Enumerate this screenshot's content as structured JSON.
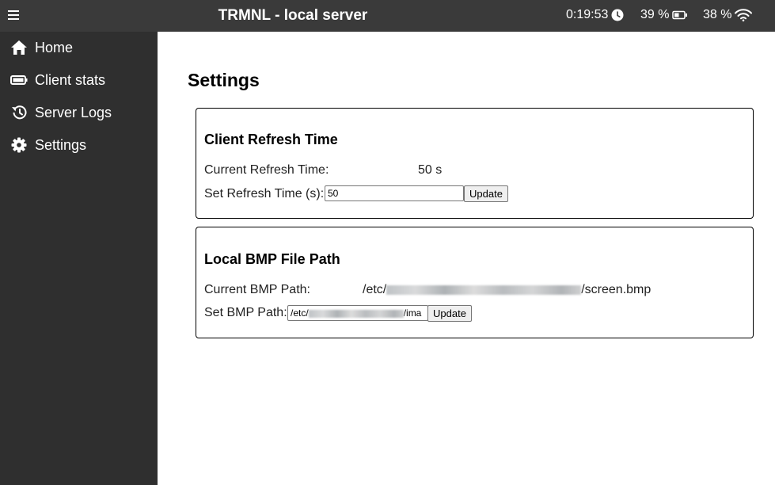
{
  "header": {
    "title": "TRMNL - local server",
    "time": "0:19:53",
    "battery": "39 %",
    "wifi": "38 %"
  },
  "sidebar": {
    "items": [
      {
        "label": "Home",
        "icon": "home-icon"
      },
      {
        "label": "Client stats",
        "icon": "battery-icon"
      },
      {
        "label": "Server Logs",
        "icon": "history-icon"
      },
      {
        "label": "Settings",
        "icon": "gear-icon"
      }
    ]
  },
  "page": {
    "title": "Settings"
  },
  "refresh": {
    "heading": "Client Refresh Time",
    "current_label": "Current Refresh Time:",
    "current_value": "50 s",
    "set_label": "Set Refresh Time (s):",
    "input_value": "50",
    "button": "Update"
  },
  "bmp": {
    "heading": "Local BMP File Path",
    "current_label": "Current BMP Path:",
    "current_prefix": "/etc/",
    "current_suffix": "/screen.bmp",
    "set_label": "Set BMP Path:",
    "input_prefix": "/etc/",
    "input_suffix": "/ima",
    "button": "Update"
  },
  "colors": {
    "topbar": "#3a3a3a",
    "sidebar": "#2f2f2f",
    "background": "#ffffff"
  }
}
